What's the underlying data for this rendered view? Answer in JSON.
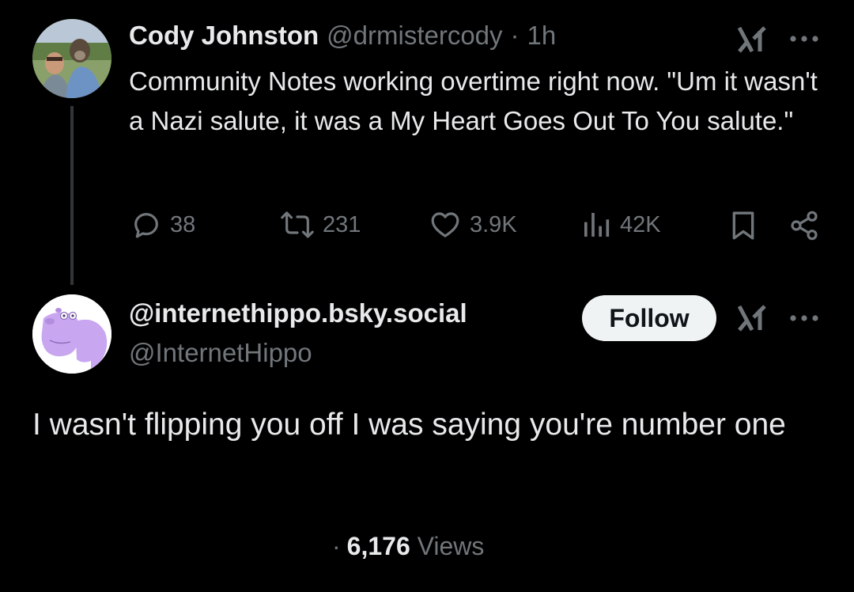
{
  "tweet": {
    "author_name": "Cody Johnston",
    "author_handle": "@drmistercody",
    "separator": "·",
    "time": "1h",
    "text": "Community Notes working overtime right now. \"Um it wasn't a Nazi salute, it was a My Heart Goes Out To You salute.\"",
    "actions": {
      "replies": "38",
      "reposts": "231",
      "likes": "3.9K",
      "views": "42K"
    }
  },
  "reply": {
    "author_name": "@internethippo.bsky.social",
    "author_handle": "@InternetHippo",
    "follow_label": "Follow",
    "text": "I wasn't flipping you off I was saying you're number one",
    "views_separator": "·",
    "views_count": "6,176",
    "views_label": "Views"
  },
  "icons": {
    "more": "more-dots-icon",
    "grok": "grok-icon",
    "reply": "reply-icon",
    "repost": "repost-icon",
    "like": "heart-icon",
    "views": "analytics-icon",
    "bookmark": "bookmark-icon",
    "share": "share-icon"
  },
  "colors": {
    "background": "#000000",
    "primary_text": "#e7e9ea",
    "secondary_text": "#71767b",
    "follow_button_bg": "#eff3f4",
    "hippo_purple": "#c9a6f0"
  }
}
